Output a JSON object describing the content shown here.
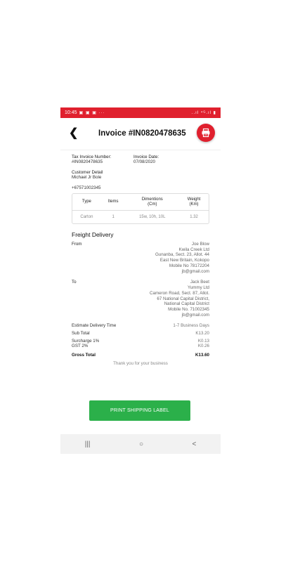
{
  "status": {
    "time": "10:45",
    "right": "..ıl ⁴ᴳ.ıl ▮"
  },
  "header": {
    "title": "Invoice #IN0820478635"
  },
  "invoice": {
    "tax_label": "Tax Invoice Number:",
    "tax_value": "#IN0820478635",
    "date_label": "Invoice Date:",
    "date_value": "07/08/2020",
    "customer_label": "Customer Detail",
    "customer_name": "Michael Jr Bole",
    "phone": "+67571002345"
  },
  "items_table": {
    "headers": [
      "Type",
      "Items",
      "Dimentions\n(Cm)",
      "Weight\n(Km)"
    ],
    "rows": [
      [
        "Carton",
        "1",
        "15w, 10h, 10L",
        "1.32"
      ]
    ]
  },
  "section_title": "Freight Delivery",
  "from": {
    "label": "From",
    "lines": [
      "Joe Blow",
      "Kwila Creek Ltd",
      "Gunanba, Sect. 23, Allot. 44",
      "East New Britain, Kokopo",
      "Mobile No 78172204",
      "jb@gmail.com"
    ]
  },
  "to": {
    "label": "To",
    "lines": [
      "Jack Beet",
      "Yummy Ltd",
      "Cameron Road, Sect. 87, Allot.",
      "67 National Capital District,",
      "National Capital District",
      "Mobile No. 71002345",
      "jb@gmail.com"
    ]
  },
  "summary": {
    "delivery_label": "Estimate Delivery Time",
    "delivery_value": "1-7 Business Days",
    "subtotal_label": "Sub Total",
    "subtotal_value": "K13.20",
    "surcharge_label": "Surcharge 1%",
    "surcharge_value": "K0.13",
    "gst_label": "GST 2%",
    "gst_value": "K0.26",
    "gross_label": "Gross Total",
    "gross_value": "K13.60"
  },
  "thanks": "Thank you for your business",
  "cta_label": "PRINT SHIPPING LABEL",
  "nav": {
    "recents": "|||",
    "home": "○",
    "back": "<"
  },
  "colors": {
    "accent": "#e0202e",
    "cta": "#2bb04a"
  }
}
